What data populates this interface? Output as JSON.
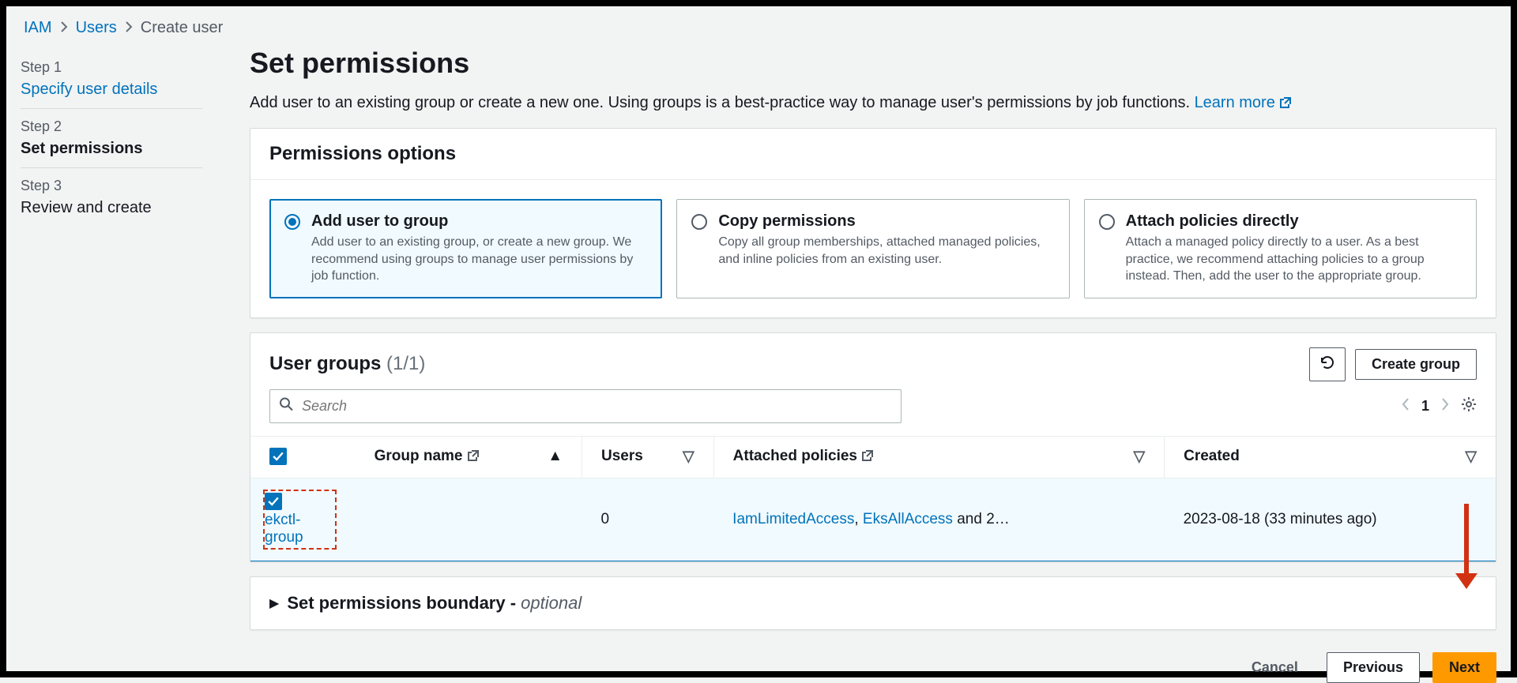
{
  "breadcrumb": {
    "root": "IAM",
    "mid": "Users",
    "current": "Create user"
  },
  "steps": [
    {
      "label": "Step 1",
      "title": "Specify user details"
    },
    {
      "label": "Step 2",
      "title": "Set permissions"
    },
    {
      "label": "Step 3",
      "title": "Review and create"
    }
  ],
  "header": {
    "title": "Set permissions",
    "subtitle": "Add user to an existing group or create a new one. Using groups is a best-practice way to manage user's permissions by job functions. ",
    "learn_more": "Learn more"
  },
  "perm_options": {
    "heading": "Permissions options",
    "items": [
      {
        "title": "Add user to group",
        "desc": "Add user to an existing group, or create a new group. We recommend using groups to manage user permissions by job function."
      },
      {
        "title": "Copy permissions",
        "desc": "Copy all group memberships, attached managed policies, and inline policies from an existing user."
      },
      {
        "title": "Attach policies directly",
        "desc": "Attach a managed policy directly to a user. As a best practice, we recommend attaching policies to a group instead. Then, add the user to the appropriate group."
      }
    ]
  },
  "groups": {
    "heading": "User groups",
    "count": "(1/1)",
    "create_label": "Create group",
    "search_placeholder": "Search",
    "page": "1",
    "columns": {
      "name": "Group name",
      "users": "Users",
      "policies": "Attached policies",
      "created": "Created"
    },
    "rows": [
      {
        "name": "ekctl-group",
        "users": "0",
        "policies_a": "IamLimitedAccess",
        "policies_sep": ", ",
        "policies_b": "EksAllAccess",
        "policies_more": " and 2…",
        "created": "2023-08-18 (33 minutes ago)"
      }
    ]
  },
  "boundary": {
    "label": "Set permissions boundary - ",
    "optional": "optional"
  },
  "footer": {
    "cancel": "Cancel",
    "previous": "Previous",
    "next": "Next"
  }
}
